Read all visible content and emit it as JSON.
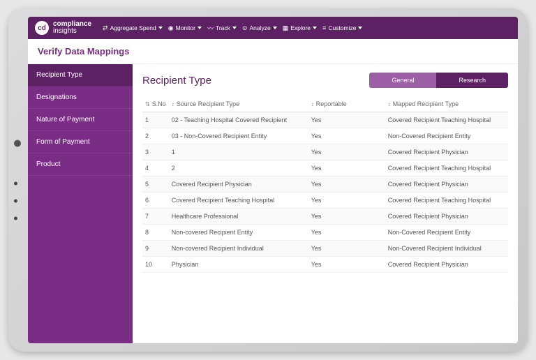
{
  "brand": {
    "badge": "cd",
    "name": "compliance",
    "sub": "insights"
  },
  "nav": [
    {
      "label": "Aggregate Spend"
    },
    {
      "label": "Monitor"
    },
    {
      "label": "Track"
    },
    {
      "label": "Analyze"
    },
    {
      "label": "Explore"
    },
    {
      "label": "Customize"
    }
  ],
  "page_heading": "Verify Data Mappings",
  "sidebar": [
    {
      "label": "Recipient Type",
      "active": true
    },
    {
      "label": "Designations"
    },
    {
      "label": "Nature of Payment"
    },
    {
      "label": "Form of Payment"
    },
    {
      "label": "Product"
    }
  ],
  "main": {
    "title": "Recipient Type",
    "tabs": {
      "general": "General",
      "research": "Research",
      "active": "research"
    }
  },
  "table": {
    "columns": [
      "S.No",
      "Source Recipient Type",
      "Reportable",
      "Mapped Recipient Type"
    ],
    "rows": [
      {
        "sno": "1",
        "src": "02 - Teaching Hospital Covered Recipient",
        "rep": "Yes",
        "map": "Covered Recipient Teaching Hospital"
      },
      {
        "sno": "2",
        "src": "03 - Non-Covered Recipient Entity",
        "rep": "Yes",
        "map": "Non-Covered Recipient Entity"
      },
      {
        "sno": "3",
        "src": "1",
        "rep": "Yes",
        "map": "Covered Recipient Physician"
      },
      {
        "sno": "4",
        "src": "2",
        "rep": "Yes",
        "map": "Covered Recipient Teaching Hospital"
      },
      {
        "sno": "5",
        "src": "Covered Recipient Physician",
        "rep": "Yes",
        "map": "Covered Recipient Physician"
      },
      {
        "sno": "6",
        "src": "Covered Recipient Teaching Hospital",
        "rep": "Yes",
        "map": "Covered Recipient Teaching Hospital"
      },
      {
        "sno": "7",
        "src": "Healthcare Professional",
        "rep": "Yes",
        "map": "Covered Recipient Physician"
      },
      {
        "sno": "8",
        "src": "Non-covered Recipient Entity",
        "rep": "Yes",
        "map": "Non-Covered Recipient Entity"
      },
      {
        "sno": "9",
        "src": "Non-covered Recipient Individual",
        "rep": "Yes",
        "map": "Non-Covered Recipient Individual"
      },
      {
        "sno": "10",
        "src": "Physician",
        "rep": "Yes",
        "map": "Covered Recipient Physician"
      }
    ]
  }
}
